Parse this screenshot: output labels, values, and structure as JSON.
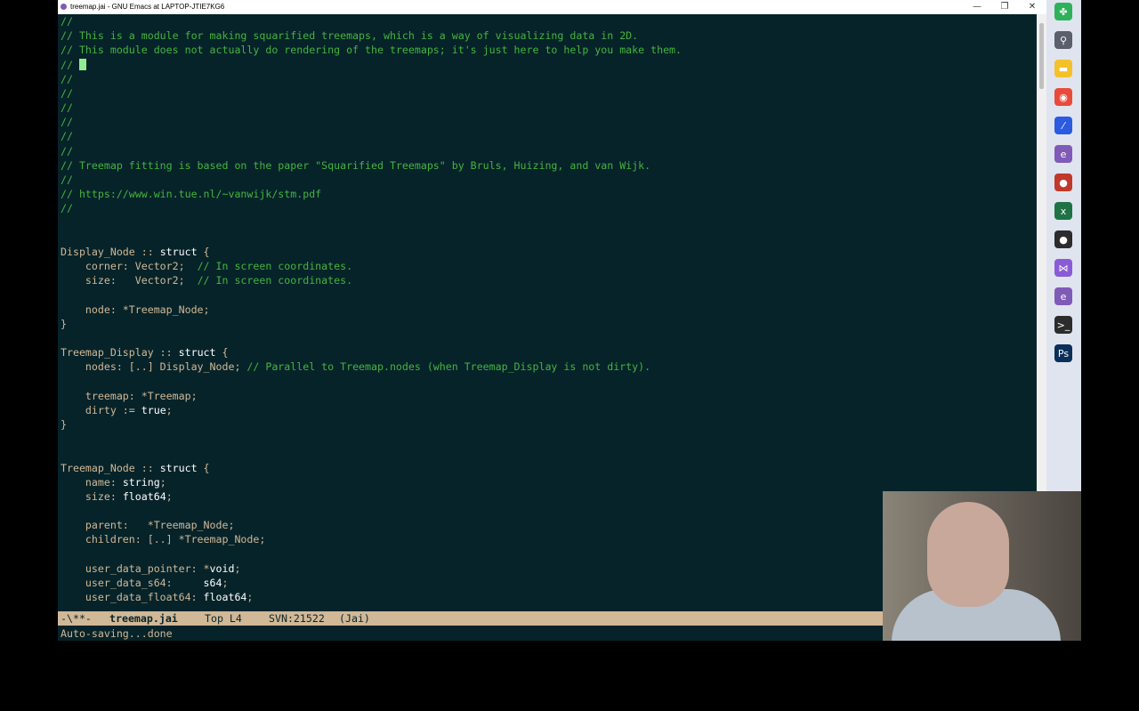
{
  "window": {
    "title": "treemap.jai - GNU Emacs at LAPTOP-JTIE7KG6",
    "controls": {
      "minimize": "—",
      "maximize": "❐",
      "close": "✕"
    }
  },
  "editor": {
    "lines": [
      {
        "segments": [
          {
            "t": "//",
            "k": "c"
          }
        ]
      },
      {
        "segments": [
          {
            "t": "// This is a module for making squarified treemaps, which is a way of visualizing data in 2D.",
            "k": "c"
          }
        ]
      },
      {
        "segments": [
          {
            "t": "// This module does not actually do rendering of the treemaps; it's just here to help you make them.",
            "k": "c"
          }
        ]
      },
      {
        "segments": [
          {
            "t": "// ",
            "k": "c"
          }
        ],
        "cursor": true
      },
      {
        "segments": [
          {
            "t": "//",
            "k": "c"
          }
        ]
      },
      {
        "segments": [
          {
            "t": "//",
            "k": "c"
          }
        ]
      },
      {
        "segments": [
          {
            "t": "//",
            "k": "c"
          }
        ]
      },
      {
        "segments": [
          {
            "t": "//",
            "k": "c"
          }
        ]
      },
      {
        "segments": [
          {
            "t": "//",
            "k": "c"
          }
        ]
      },
      {
        "segments": [
          {
            "t": "//",
            "k": "c"
          }
        ]
      },
      {
        "segments": [
          {
            "t": "// Treemap fitting is based on the paper \"Squarified Treemaps\" by Bruls, Huizing, and van Wijk.",
            "k": "c"
          }
        ]
      },
      {
        "segments": [
          {
            "t": "//",
            "k": "c"
          }
        ]
      },
      {
        "segments": [
          {
            "t": "// https://www.win.tue.nl/~vanwijk/stm.pdf",
            "k": "c"
          }
        ]
      },
      {
        "segments": [
          {
            "t": "//",
            "k": "c"
          }
        ]
      },
      {
        "segments": []
      },
      {
        "segments": []
      },
      {
        "segments": [
          {
            "t": "Display_Node :: ",
            "k": "n"
          },
          {
            "t": "struct",
            "k": "kw"
          },
          {
            "t": " {",
            "k": "n"
          }
        ]
      },
      {
        "segments": [
          {
            "t": "    corner: Vector2;  ",
            "k": "n"
          },
          {
            "t": "// In screen coordinates.",
            "k": "c"
          }
        ]
      },
      {
        "segments": [
          {
            "t": "    size:   Vector2;  ",
            "k": "n"
          },
          {
            "t": "// In screen coordinates.",
            "k": "c"
          }
        ]
      },
      {
        "segments": []
      },
      {
        "segments": [
          {
            "t": "    node: *Treemap_Node;",
            "k": "n"
          }
        ]
      },
      {
        "segments": [
          {
            "t": "}",
            "k": "n"
          }
        ]
      },
      {
        "segments": []
      },
      {
        "segments": [
          {
            "t": "Treemap_Display :: ",
            "k": "n"
          },
          {
            "t": "struct",
            "k": "kw"
          },
          {
            "t": " {",
            "k": "n"
          }
        ]
      },
      {
        "segments": [
          {
            "t": "    nodes: [..] Display_Node; ",
            "k": "n"
          },
          {
            "t": "// Parallel to Treemap.nodes (when Treemap_Display is not dirty).",
            "k": "c"
          }
        ]
      },
      {
        "segments": []
      },
      {
        "segments": [
          {
            "t": "    treemap: *Treemap;",
            "k": "n"
          }
        ]
      },
      {
        "segments": [
          {
            "t": "    dirty := ",
            "k": "n"
          },
          {
            "t": "true",
            "k": "val"
          },
          {
            "t": ";",
            "k": "n"
          }
        ]
      },
      {
        "segments": [
          {
            "t": "}",
            "k": "n"
          }
        ]
      },
      {
        "segments": []
      },
      {
        "segments": []
      },
      {
        "segments": [
          {
            "t": "Treemap_Node :: ",
            "k": "n"
          },
          {
            "t": "struct",
            "k": "kw"
          },
          {
            "t": " {",
            "k": "n"
          }
        ]
      },
      {
        "segments": [
          {
            "t": "    name: ",
            "k": "n"
          },
          {
            "t": "string",
            "k": "val"
          },
          {
            "t": ";",
            "k": "n"
          }
        ]
      },
      {
        "segments": [
          {
            "t": "    size: ",
            "k": "n"
          },
          {
            "t": "float64",
            "k": "val"
          },
          {
            "t": ";",
            "k": "n"
          }
        ]
      },
      {
        "segments": []
      },
      {
        "segments": [
          {
            "t": "    parent:   *Treemap_Node;",
            "k": "n"
          }
        ]
      },
      {
        "segments": [
          {
            "t": "    children: [..] *Treemap_Node;",
            "k": "n"
          }
        ]
      },
      {
        "segments": []
      },
      {
        "segments": [
          {
            "t": "    user_data_pointer: *",
            "k": "n"
          },
          {
            "t": "void",
            "k": "val"
          },
          {
            "t": ";",
            "k": "n"
          }
        ]
      },
      {
        "segments": [
          {
            "t": "    user_data_s64:     ",
            "k": "n"
          },
          {
            "t": "s64",
            "k": "val"
          },
          {
            "t": ";",
            "k": "n"
          }
        ]
      },
      {
        "segments": [
          {
            "t": "    user_data_float64: ",
            "k": "n"
          },
          {
            "t": "float64",
            "k": "val"
          },
          {
            "t": ";",
            "k": "n"
          }
        ]
      }
    ]
  },
  "modeline": {
    "status": "-\\**-",
    "buffer": "treemap.jai",
    "position": "Top L4",
    "vc": "SVN:21522",
    "mode": "(Jai)"
  },
  "minibuffer": {
    "message": "Auto-saving...done"
  },
  "taskbar": {
    "items": [
      {
        "name": "clover-app-icon",
        "glyph": "✤",
        "color": "#2fb15a"
      },
      {
        "name": "search-icon",
        "glyph": "⚲",
        "color": "#5a5f6b"
      },
      {
        "name": "file-explorer-icon",
        "glyph": "▬",
        "color": "#f4c12b"
      },
      {
        "name": "chrome-icon",
        "glyph": "◉",
        "color": "#e84b3c"
      },
      {
        "name": "code-editor-icon",
        "glyph": "⁄",
        "color": "#2b5be0"
      },
      {
        "name": "emacs-icon",
        "glyph": "e",
        "color": "#7f5ab6"
      },
      {
        "name": "recorder-icon",
        "glyph": "●",
        "color": "#c0392b"
      },
      {
        "name": "excel-icon",
        "glyph": "x",
        "color": "#1f7244"
      },
      {
        "name": "obs-icon",
        "glyph": "●",
        "color": "#2c2c2c"
      },
      {
        "name": "visual-studio-icon",
        "glyph": "⋈",
        "color": "#8a5bd6"
      },
      {
        "name": "emacs-icon-2",
        "glyph": "e",
        "color": "#7f5ab6"
      },
      {
        "name": "terminal-icon",
        "glyph": ">_",
        "color": "#2c2c2c"
      },
      {
        "name": "photoshop-icon",
        "glyph": "Ps",
        "color": "#0b2f5a"
      }
    ]
  }
}
